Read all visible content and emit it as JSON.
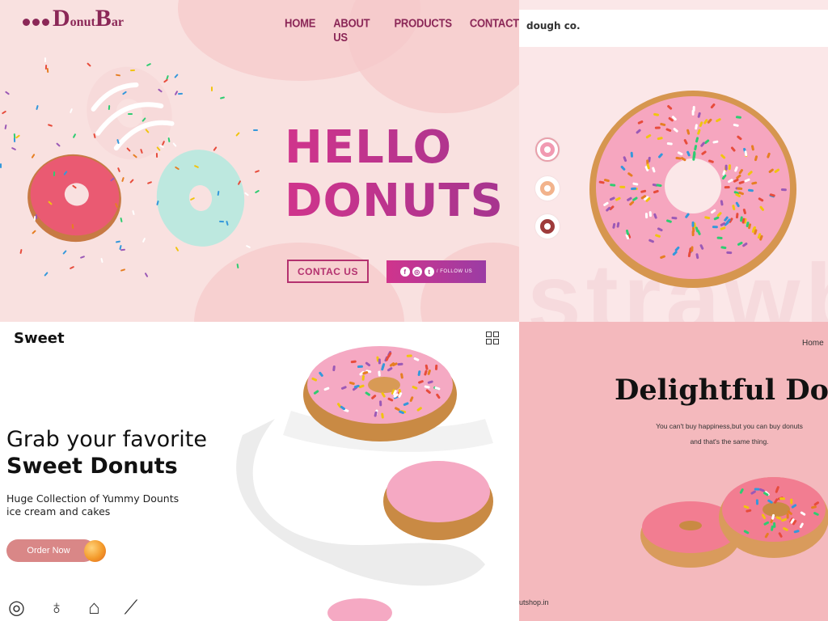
{
  "q1": {
    "logo_big1": "D",
    "logo_small1": "onut",
    "logo_big2": "B",
    "logo_small2": "ar",
    "nav": [
      "HOME",
      "ABOUT US",
      "PRODUCTS",
      "CONTACT"
    ],
    "hello_line1": "HELLO",
    "hello_line2": "DONUTS",
    "contact_button": "CONTAC US",
    "follow_label": "/ FOLLOW US",
    "social_icons": [
      "facebook-icon",
      "instagram-icon",
      "twitter-icon"
    ],
    "colors": {
      "brand": "#8b2757",
      "accent": "#d0348c",
      "background": "#f9e1e0"
    }
  },
  "q2": {
    "brand": "dough co.",
    "watermark": "strawb",
    "colors": {
      "background": "#fbe7e8",
      "thumb_ring": "#e8a0ab"
    }
  },
  "q3": {
    "brand": "Sweet",
    "headline1": "Grab your favorite",
    "headline2": "Sweet Donuts",
    "desc_line1": "Huge Collection of Yummy Dounts",
    "desc_line2": "ice cream and cakes",
    "order_button": "Order Now",
    "category_icons": [
      "donut-icon",
      "ice-cream-icon",
      "cake-icon",
      "bread-icon"
    ],
    "colors": {
      "button": "#d98787"
    }
  },
  "q4": {
    "nav_home": "Home",
    "title": "Delightful Donu",
    "subtitle_line1": "You can't buy happiness,but you can buy donuts",
    "subtitle_line2": "and that's the same thing.",
    "footer_fragment": "utshop.in",
    "colors": {
      "background": "#f4b9bd"
    }
  }
}
